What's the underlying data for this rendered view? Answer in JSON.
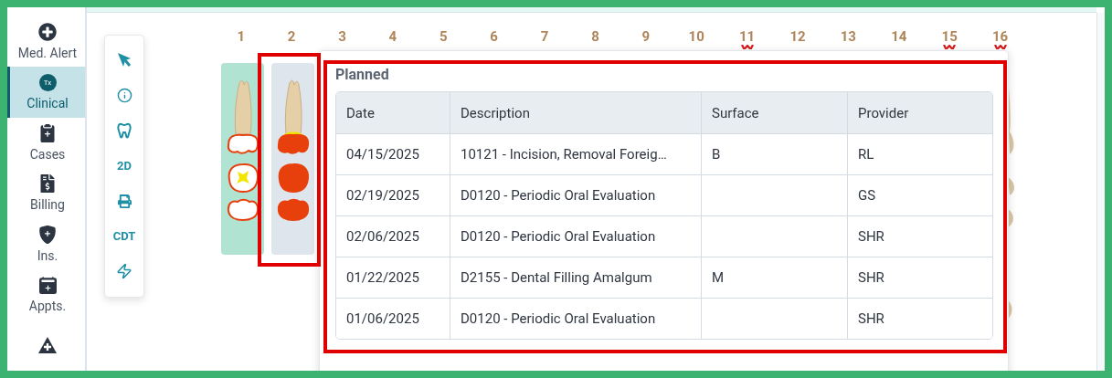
{
  "sidebar": {
    "items": [
      {
        "label": "Med. Alert",
        "selected": false
      },
      {
        "label": "Clinical",
        "icon_text": "Tx",
        "selected": true
      },
      {
        "label": "Cases",
        "selected": false
      },
      {
        "label": "Billing",
        "selected": false
      },
      {
        "label": "Ins.",
        "selected": false
      },
      {
        "label": "Appts.",
        "selected": false
      },
      {
        "selected": false
      }
    ]
  },
  "toolbar": {
    "tools": [
      {
        "kind": "pointer"
      },
      {
        "kind": "info"
      },
      {
        "kind": "tooth"
      },
      {
        "kind": "text",
        "label": "2D"
      },
      {
        "kind": "print"
      },
      {
        "kind": "text",
        "label": "CDT"
      },
      {
        "kind": "flash"
      }
    ]
  },
  "tooth_chart": {
    "numbers": [
      {
        "label": "1",
        "flagged": false
      },
      {
        "label": "2",
        "flagged": false
      },
      {
        "label": "3",
        "flagged": false
      },
      {
        "label": "4",
        "flagged": false
      },
      {
        "label": "5",
        "flagged": false
      },
      {
        "label": "6",
        "flagged": false
      },
      {
        "label": "7",
        "flagged": false
      },
      {
        "label": "8",
        "flagged": false
      },
      {
        "label": "9",
        "flagged": false
      },
      {
        "label": "10",
        "flagged": false
      },
      {
        "label": "11",
        "flagged": true
      },
      {
        "label": "12",
        "flagged": false
      },
      {
        "label": "13",
        "flagged": false
      },
      {
        "label": "14",
        "flagged": false
      },
      {
        "label": "15",
        "flagged": true
      },
      {
        "label": "16",
        "flagged": true
      }
    ],
    "teeth": [
      {
        "selected": false,
        "filled": false
      },
      {
        "selected": true,
        "filled": true
      }
    ]
  },
  "popup": {
    "title": "Planned",
    "table": {
      "columns": [
        "Date",
        "Description",
        "Surface",
        "Provider"
      ],
      "rows": [
        [
          "04/15/2025",
          "10121 - Incision, Removal Foreig…",
          "B",
          "RL"
        ],
        [
          "02/19/2025",
          "D0120 - Periodic Oral Evaluation",
          "",
          "GS"
        ],
        [
          "02/06/2025",
          "D0120 - Periodic Oral Evaluation",
          "",
          "SHR"
        ],
        [
          "01/22/2025",
          "D2155 - Dental Filling Amalgum",
          "M",
          "SHR"
        ],
        [
          "01/06/2025",
          "D0120 - Periodic Oral Evaluation",
          "",
          "SHR"
        ]
      ]
    }
  }
}
